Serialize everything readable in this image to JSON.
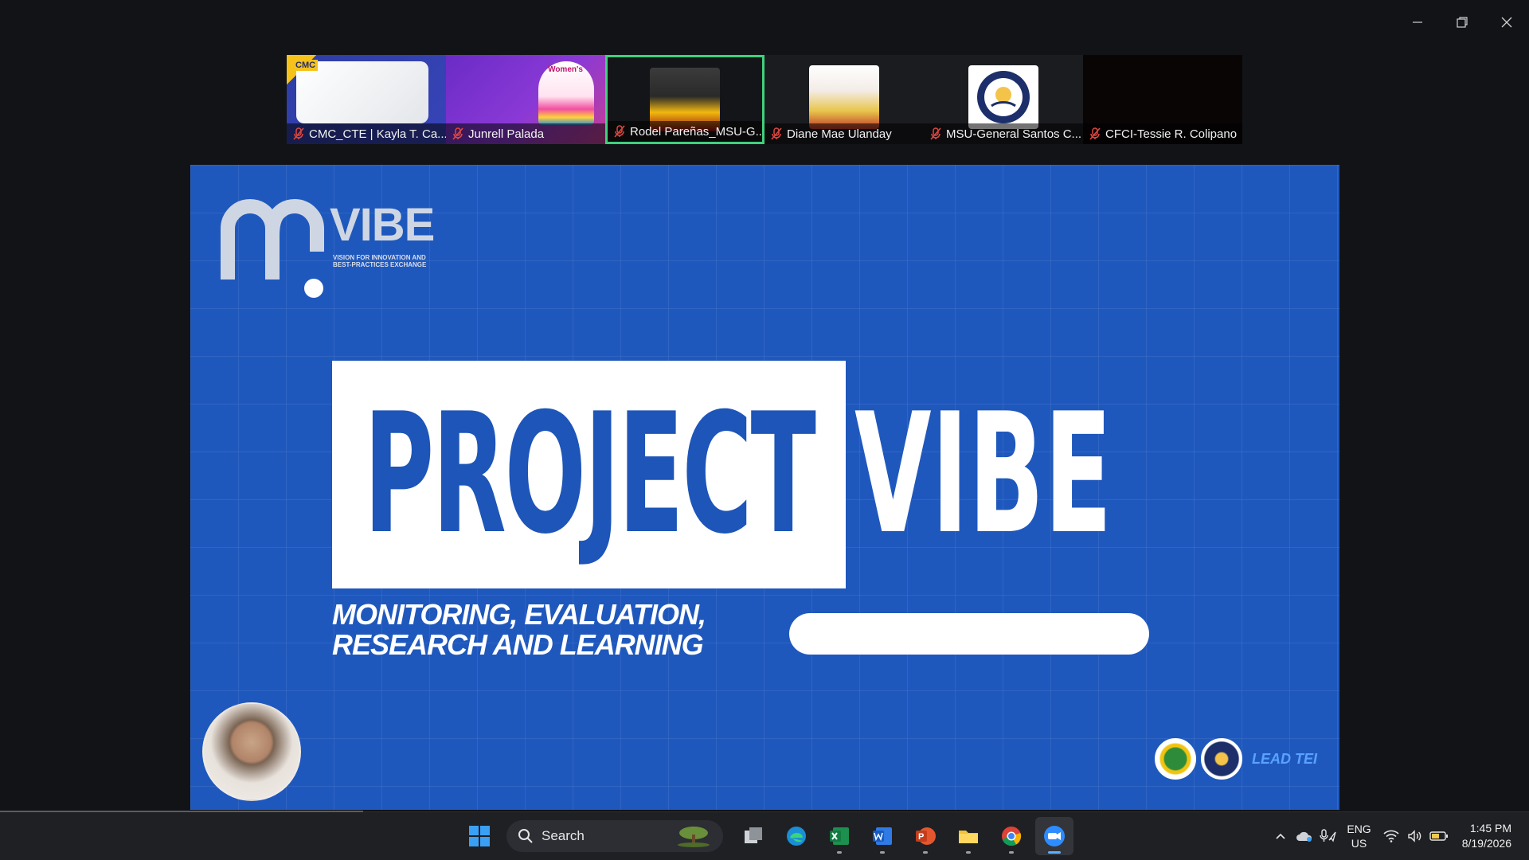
{
  "window": {
    "controls": [
      "minimize",
      "restore",
      "close"
    ]
  },
  "participants": [
    {
      "name": "CMC_CTE | Kayla T. Ca...",
      "muted": true,
      "thumb_text": "CMC"
    },
    {
      "name": "Junrell Palada",
      "muted": true,
      "thumb_text": "Women's"
    },
    {
      "name": "Rodel Pareñas_MSU-G...",
      "muted": true,
      "speaking": true
    },
    {
      "name": "Diane Mae Ulanday",
      "muted": true
    },
    {
      "name": "MSU-General Santos C...",
      "muted": true
    },
    {
      "name": "CFCI-Tessie R. Colipano",
      "muted": true
    }
  ],
  "slide": {
    "logo_word": "VIBE",
    "logo_subtitle": "VISION FOR INNOVATION AND BEST-PRACTICES EXCHANGE",
    "title_boxed": "PROJECT",
    "title_plain": "VIBE",
    "subtitle_line1": "MONITORING, EVALUATION,",
    "subtitle_line2": "RESEARCH AND LEARNING",
    "partner_text": "LEAD TEI",
    "colors": {
      "background": "#1f58bd",
      "title_blue": "#1d55b8"
    }
  },
  "taskbar": {
    "search_placeholder": "Search",
    "apps": [
      "windows-start",
      "task-view",
      "edge",
      "excel",
      "word",
      "powerpoint",
      "file-explorer",
      "chrome",
      "zoom"
    ],
    "language_line1": "ENG",
    "language_line2": "US",
    "time": "1:45 PM",
    "date": "8/19/2026"
  }
}
